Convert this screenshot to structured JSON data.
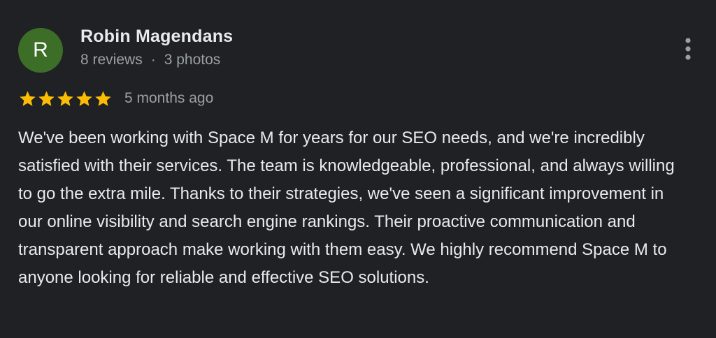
{
  "author": {
    "initial": "R",
    "name": "Robin Magendans",
    "reviews": "8 reviews",
    "separator": "·",
    "photos": "3 photos",
    "avatar_color": "#3d6e28"
  },
  "rating": {
    "stars": 5,
    "max_stars": 5,
    "star_color": "#fbbc04",
    "time_ago": "5 months ago"
  },
  "review": {
    "text": "We've been working with Space M for years for our SEO needs, and we're incredibly satisfied with their services. The team is knowledgeable, professional, and always willing to go the extra mile. Thanks to their strategies, we've seen a significant improvement in our online visibility and search engine rankings. Their proactive communication and transparent approach make working with them easy. We highly recommend Space M to anyone looking for reliable and effective SEO solutions."
  },
  "icons": {
    "more": "more-vert-icon",
    "star": "star-icon"
  }
}
